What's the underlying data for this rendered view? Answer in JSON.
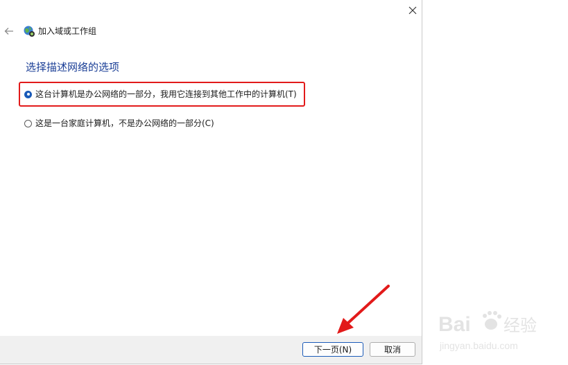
{
  "wizard": {
    "title": "加入域或工作组"
  },
  "main": {
    "heading": "选择描述网络的选项",
    "options": [
      {
        "label": "这台计算机是办公网络的一部分，我用它连接到其他工作中的计算机(T)",
        "checked": true
      },
      {
        "label": "这是一台家庭计算机，不是办公网络的一部分(C)",
        "checked": false
      }
    ]
  },
  "footer": {
    "next_label": "下一页(N)",
    "cancel_label": "取消"
  },
  "icons": {
    "close": "close-icon",
    "back": "back-arrow-icon",
    "wizard": "network-globe-icon"
  },
  "annotations": {
    "highlight_color": "#e21a1a",
    "arrow_color": "#e21a1a"
  },
  "watermark": {
    "brand": "Bai",
    "brand2": "du",
    "sub": "经验",
    "url": "jingyan.baidu.com"
  }
}
